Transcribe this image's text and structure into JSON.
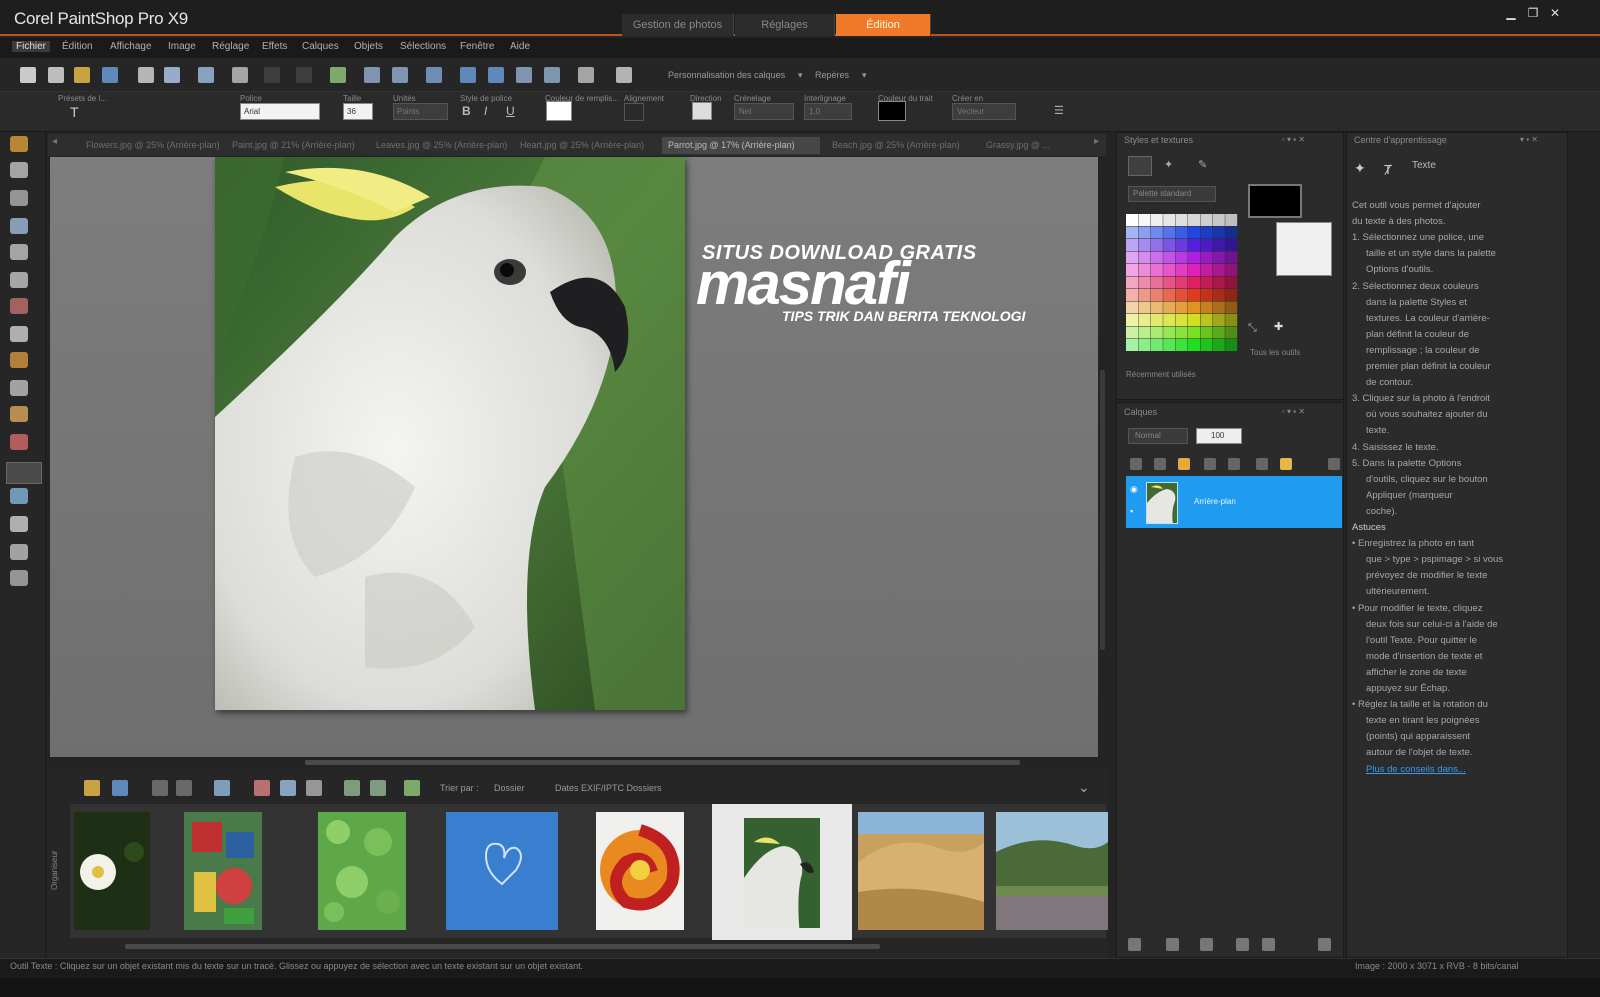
{
  "app": {
    "title": "Corel PaintShop Pro X9",
    "workspace_tabs": [
      "Gestion de photos",
      "Réglages",
      "Édition"
    ],
    "active_workspace": 2
  },
  "menu": {
    "items": [
      "Fichier",
      "Édition",
      "Affichage",
      "Image",
      "Réglage",
      "Effets",
      "Calques",
      "Objets",
      "Sélections",
      "Fenêtre",
      "Aide"
    ],
    "active_index": 0
  },
  "toolbar": {
    "workspace_label": "Personnalisation des calques",
    "layout_label": "Repères"
  },
  "options_bar": {
    "labels": [
      "Présets de l...",
      "Police",
      "Taille",
      "Unités",
      "Style de police",
      "Couleur de remplis...",
      "Alignement",
      "Direction",
      "Crénelage",
      "Espacement",
      "Interlignage",
      "Largeur du trait",
      "Couleur du trait",
      "Créer en"
    ],
    "font_value": "Arial",
    "size_value": "36",
    "units_value": "Points",
    "antialias_value": "Net",
    "leading_value": "1,0",
    "create_as_value": "Vecteur",
    "style_buttons": [
      "B",
      "I",
      "U"
    ]
  },
  "doc_tabs": [
    "Flowers.jpg @ 25% (Arrière-plan)",
    "Paint.jpg @ 21% (Arrière-plan)",
    "Leaves.jpg @ 25% (Arrière-plan)",
    "Heart.jpg @ 25% (Arrière-plan)",
    "Parrot.jpg @ 17% (Arrière-plan)",
    "Beach.jpg @ 25% (Arrière-plan)",
    "Grassy.jpg @ ..."
  ],
  "active_doc_tab": 4,
  "watermark": {
    "line1": "SITUS DOWNLOAD GRATIS",
    "brand": "masnafi",
    "line3": "TIPS TRIK DAN BERITA TEKNOLOGI"
  },
  "organizer": {
    "side_label": "Organiseur",
    "sort_label": "Trier par :",
    "sort_value": "Dossier",
    "folder_label": "Dates EXIF/IPTC Dossiers",
    "thumbnails": [
      "flower",
      "paint",
      "leaves",
      "heart",
      "swirl",
      "parrot",
      "desert",
      "meadow"
    ],
    "selected_thumbnail": 5
  },
  "materials_panel": {
    "title": "Styles et textures",
    "palette_select": "Palette standard",
    "all_tools": "Tous les outils",
    "recent_label": "Récemment utilisés"
  },
  "layers_panel": {
    "title": "Calques",
    "blend_mode": "Normal",
    "opacity": "100",
    "layer_name": "Arrière-plan"
  },
  "learning_panel": {
    "title": "Centre d'apprentissage",
    "tool_name": "Texte",
    "lines": [
      "Cet outil vous permet d'ajouter",
      "du texte à des photos.",
      "1. Sélectionnez une police, une",
      "taille et un style dans la palette",
      "Options d'outils.",
      "2. Sélectionnez deux couleurs",
      "dans la palette Styles et",
      "textures. La couleur d'arrière-",
      "plan définit la couleur de",
      "remplissage ; la couleur de",
      "premier plan définit la couleur",
      "de contour.",
      "3. Cliquez sur la photo à l'endroit",
      "où vous souhaitez ajouter du",
      "texte.",
      "4. Saisissez le texte.",
      "5. Dans la palette Options",
      "d'outils, cliquez sur le bouton",
      "Appliquer (marqueur",
      "coche).",
      "Astuces",
      "• Enregistrez la photo en tant",
      "que > type > pspimage > si vous",
      "prévoyez de modifier le texte",
      "ultérieurement.",
      "• Pour modifier le texte, cliquez",
      "deux fois sur celui-ci à l'aide de",
      "l'outil Texte. Pour quitter le",
      "mode d'insertion de texte et",
      "afficher le zone de texte",
      "appuyez sur Échap.",
      "• Réglez la taille et la rotation du",
      "texte en tirant les poignées",
      "(points) qui apparaissent",
      "autour de l'objet de texte.",
      "Plus de conseils dans..."
    ]
  },
  "status": {
    "left": "Outil Texte : Cliquez sur un objet existant mis du texte sur un tracé. Glissez ou appuyez de sélection avec un texte existant sur un objet existant.",
    "right": "Image : 2000 x 3071 x RVB - 8 bits/canal"
  },
  "colors": {
    "accent_orange": "#f07a2a",
    "layer_selected": "#1f9bf0",
    "canvas_gray": "#767676"
  }
}
